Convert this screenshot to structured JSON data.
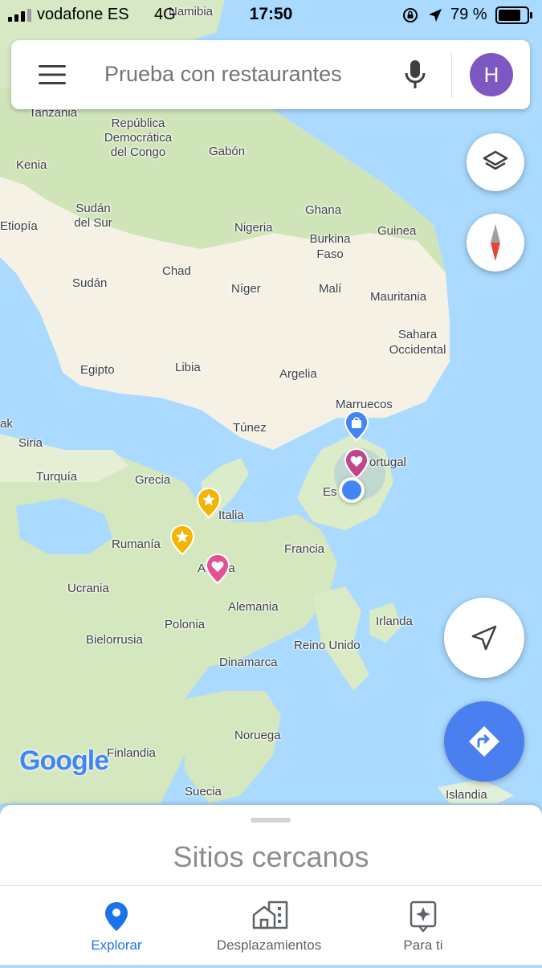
{
  "status_bar": {
    "carrier": "vodafone ES",
    "network": "4G",
    "time": "17:50",
    "battery": "79 %"
  },
  "search": {
    "placeholder": "Prueba con restaurantes",
    "avatar_letter": "H",
    "avatar_color": "#7e57c2"
  },
  "map": {
    "labels": {
      "namibia": "Namibia",
      "tanzania": "Tanzania",
      "rep_congo_1": "República",
      "rep_congo_2": "Democrática",
      "rep_congo_3": "del Congo",
      "gabon": "Gabón",
      "kenia": "Kenia",
      "sudan_sur_1": "Sudán",
      "sudan_sur_2": "del Sur",
      "etiopia": "Etiopía",
      "nigeria": "Nigeria",
      "ghana": "Ghana",
      "guinea": "Guinea",
      "burkina_1": "Burkina",
      "burkina_2": "Faso",
      "chad": "Chad",
      "sudan": "Sudán",
      "niger": "Níger",
      "mali": "Malí",
      "mauritania": "Mauritania",
      "sahara_1": "Sahara",
      "sahara_2": "Occidental",
      "egipto": "Egipto",
      "libia": "Libia",
      "argelia": "Argelia",
      "marruecos": "Marruecos",
      "tunez": "Túnez",
      "irak": "ak",
      "siria": "Siria",
      "portugal": "Portugal",
      "espana": "Es",
      "turquia": "Turquía",
      "grecia": "Grecia",
      "italia": "Italia",
      "rumania": "Rumanía",
      "austria": "Austria",
      "francia": "Francia",
      "ucrania": "Ucrania",
      "alemania": "Alemania",
      "irlanda": "Irlanda",
      "polonia": "Polonia",
      "bielorrusia": "Bielorrusia",
      "reino_unido": "Reino Unido",
      "dinamarca": "Dinamarca",
      "noruega": "Noruega",
      "finlandia": "Finlandia",
      "suecia": "Suecia",
      "islandia": "Islandia"
    },
    "logo": "Google",
    "colors": {
      "water": "#aadaff",
      "land_green": "#c8e2b0",
      "land_dry": "#f5f1e4",
      "location": "#4285f4"
    }
  },
  "controls": {
    "layers_icon": "layers-icon",
    "compass_icon": "compass-icon",
    "recenter_icon": "navigation-arrow-icon",
    "directions_icon": "directions-icon"
  },
  "sheet": {
    "title": "Sitios cercanos"
  },
  "tabs": [
    {
      "label": "Explorar",
      "icon": "location-pin-icon",
      "active": true
    },
    {
      "label": "Desplazamientos",
      "icon": "commute-icon",
      "active": false
    },
    {
      "label": "Para ti",
      "icon": "sparkle-icon",
      "active": false
    }
  ],
  "accent_color": "#1a73e8"
}
